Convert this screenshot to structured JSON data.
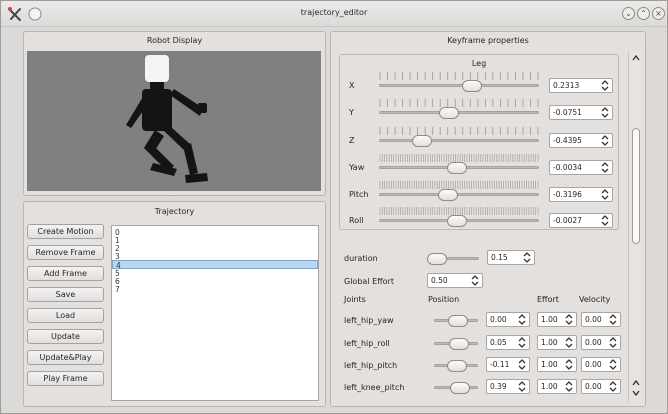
{
  "window": {
    "title": "trajectory_editor"
  },
  "icons": {
    "app": "tool-icon",
    "menu": "circle-icon",
    "minimize": "chevron-down-icon",
    "maximize": "chevron-up-icon",
    "close": "close-icon"
  },
  "robot_panel": {
    "title": "Robot Display"
  },
  "trajectory": {
    "title": "Trajectory",
    "buttons": [
      "Create Motion",
      "Remove Frame",
      "Add Frame",
      "Save",
      "Load",
      "Update",
      "Update&Play",
      "Play Frame"
    ],
    "frames": [
      "0",
      "1",
      "2",
      "3",
      "4",
      "5",
      "6",
      "7"
    ],
    "selected_index": 4
  },
  "keyframe": {
    "title": "Keyframe properties",
    "group_title": "Leg",
    "sliders": [
      {
        "label": "X",
        "value": "0.2313",
        "level": 0.58
      },
      {
        "label": "Y",
        "value": "-0.0751",
        "level": 0.44
      },
      {
        "label": "Z",
        "value": "-0.4395",
        "level": 0.27
      },
      {
        "label": "Yaw",
        "value": "-0.0034",
        "level": 0.49
      },
      {
        "label": "Pitch",
        "value": "-0.3196",
        "level": 0.43
      },
      {
        "label": "Roll",
        "value": "-0.0027",
        "level": 0.49
      }
    ],
    "duration": {
      "label": "duration",
      "value": "0.15",
      "level": 0.05
    },
    "global_effort": {
      "label": "Global Effort",
      "value": "0.50"
    },
    "joint_headers": {
      "joints": "Joints",
      "position": "Position",
      "effort": "Effort",
      "velocity": "Velocity"
    },
    "joints": [
      {
        "name": "left_hip_yaw",
        "position": "0.00",
        "effort": "1.00",
        "velocity": "0.00",
        "level": 0.5
      },
      {
        "name": "left_hip_roll",
        "position": "0.05",
        "effort": "1.00",
        "velocity": "0.00",
        "level": 0.52
      },
      {
        "name": "left_hip_pitch",
        "position": "-0.11",
        "effort": "1.00",
        "velocity": "0.00",
        "level": 0.48
      },
      {
        "name": "left_knee_pitch",
        "position": "0.39",
        "effort": "1.00",
        "velocity": "0.00",
        "level": 0.55
      }
    ]
  },
  "colors": {
    "viewport_bg": "#808080",
    "selection": "#b9d7f3",
    "robot_body": "#141414",
    "robot_head": "#f4f4f4"
  }
}
